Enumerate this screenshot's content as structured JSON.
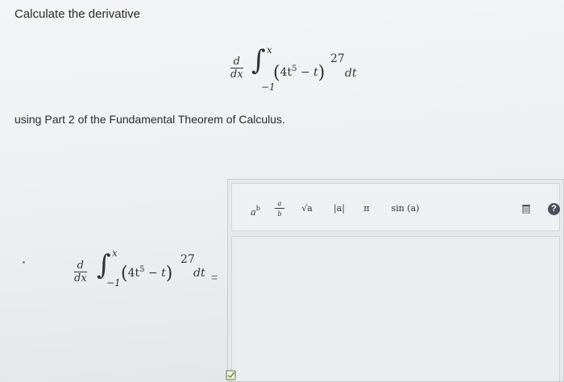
{
  "question": {
    "prompt": "Calculate the derivative",
    "tail": "using Part 2 of the Fundamental Theorem of Calculus.",
    "expression": {
      "d": "d",
      "dx": "dx",
      "upper_limit": "x",
      "lower_limit": "−1",
      "integrand_inner": "4t",
      "inner_power": "5",
      "minus_t": " − t",
      "outer_power": "27",
      "dt": "dt"
    }
  },
  "answer": {
    "equals": "=",
    "toolbar": {
      "power": {
        "base": "a",
        "exp": "b"
      },
      "fraction": {
        "num": "a",
        "den": "b"
      },
      "sqrt": "√a",
      "abs": "|a|",
      "pi": "π",
      "sin": "sin (a)",
      "help": "?"
    }
  },
  "icons": {
    "trash": "trash-icon",
    "help": "help-icon",
    "submit": "answer-submit-icon"
  },
  "colors": {
    "help_bg": "#4a4f5a",
    "background": "#eceef1"
  }
}
